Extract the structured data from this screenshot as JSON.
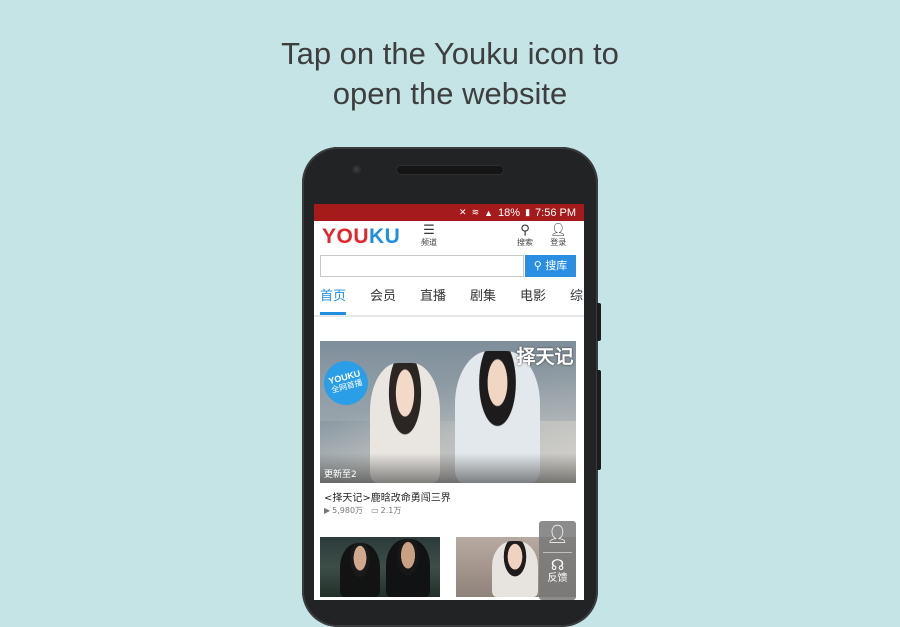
{
  "instruction": {
    "line1": "Tap on the Youku icon to",
    "line2": "open the website"
  },
  "statusbar": {
    "icons": [
      "mute-icon",
      "wifi-icon",
      "signal-icon",
      "battery-icon"
    ],
    "battery": "18%",
    "time": "7:56 PM"
  },
  "header": {
    "logo_part1": "YOU",
    "logo_part2": "KU",
    "menu_label": "频道",
    "search_label": "搜索",
    "login_label": "登录"
  },
  "search": {
    "value": "",
    "button_label": "搜库"
  },
  "tabs": [
    "首页",
    "会员",
    "直播",
    "剧集",
    "电影",
    "综"
  ],
  "banner": {
    "badge_line1": "YOUKU",
    "badge_line2": "全网首播",
    "title_art": "择天记",
    "episode": "更新至2",
    "caption": "<择天记>鹿晗改命勇闯三界",
    "views": "5,980万",
    "comments": "2.1万"
  },
  "float_panel": {
    "label": "反馈"
  },
  "colors": {
    "background": "#c4e4e5",
    "statusbar": "#a51b1b",
    "logo_red": "#e2262c",
    "logo_blue": "#1f8fe0",
    "search_button": "#2a8ee3",
    "active_tab": "#1f8fe0"
  }
}
